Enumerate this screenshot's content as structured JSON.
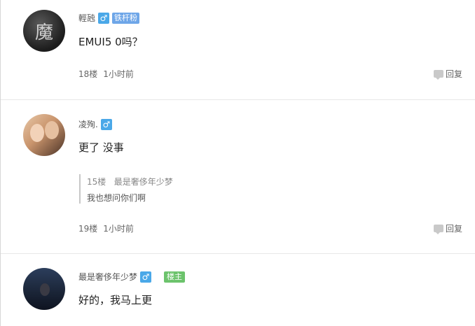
{
  "posts": [
    {
      "username": "輕瓲",
      "gender_symbol": "♂",
      "badge": "铁杆粉",
      "content": "EMUI5 0吗？",
      "floor": "18楼",
      "time": "1小时前",
      "reply_label": "回复",
      "avatar_text": "魔"
    },
    {
      "username": "凌殉.",
      "gender_symbol": "♂",
      "content": "更了  没事",
      "quote": {
        "floor": "15楼",
        "author": "最是奢侈年少梦",
        "text": "我也想问你们啊"
      },
      "floor": "19楼",
      "time": "1小时前",
      "reply_label": "回复"
    },
    {
      "username": "最是奢侈年少梦",
      "gender_symbol": "♂",
      "host_badge": "楼主",
      "content": "好的，我马上更"
    }
  ],
  "colors": {
    "gender_badge": "#4aa8e8",
    "fan_badge": "#6ea6e8",
    "host_badge": "#6cc36c"
  },
  "icons": {
    "reply": "reply-icon",
    "gender": "male-icon"
  }
}
